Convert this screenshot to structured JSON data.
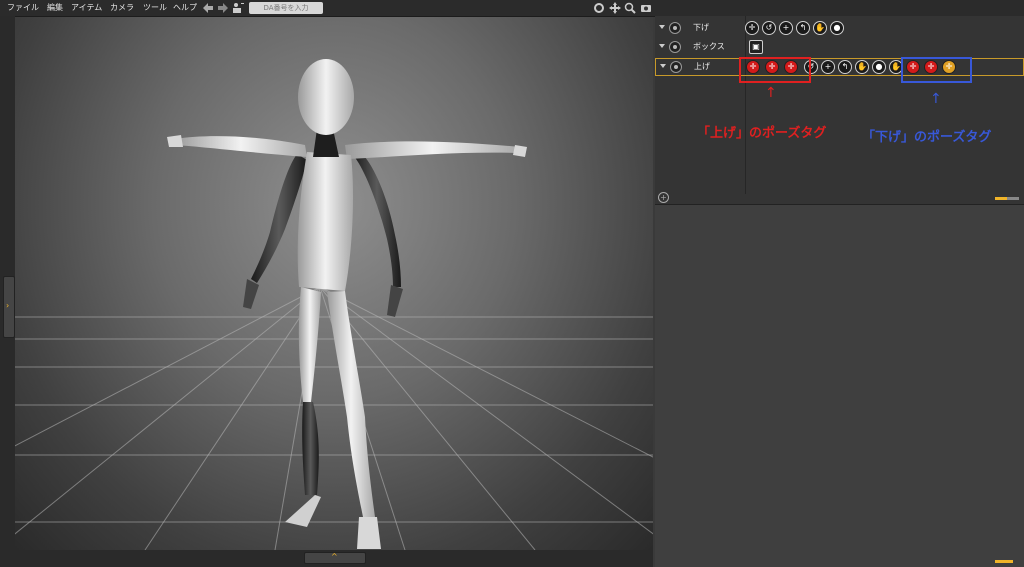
{
  "menu": {
    "items": [
      "ファイル",
      "編集",
      "アイテム",
      "カメラ",
      "ツール",
      "ヘルプ"
    ],
    "search_placeholder": "DA番号を入力"
  },
  "toolbar_icons": [
    "back-arrow-icon",
    "forward-arrow-icon",
    "figure-add-icon"
  ],
  "view_controls": [
    "rotate-icon",
    "move-icon",
    "zoom-icon",
    "camera-icon"
  ],
  "layers": [
    {
      "label": "下げ",
      "selected": false
    },
    {
      "label": "ボックス",
      "selected": false
    },
    {
      "label": "上げ",
      "selected": true
    }
  ],
  "annotations": {
    "red_label": "「上げ」のポーズタグ",
    "blue_label": "「下げ」のポーズタグ",
    "arrow_up": "↑"
  },
  "colors": {
    "accent": "#f0b429",
    "annotation_red": "#e02020",
    "annotation_blue": "#3858d8",
    "pose_tag_red": "#d31a1a",
    "pose_tag_orange": "#e0a024"
  }
}
